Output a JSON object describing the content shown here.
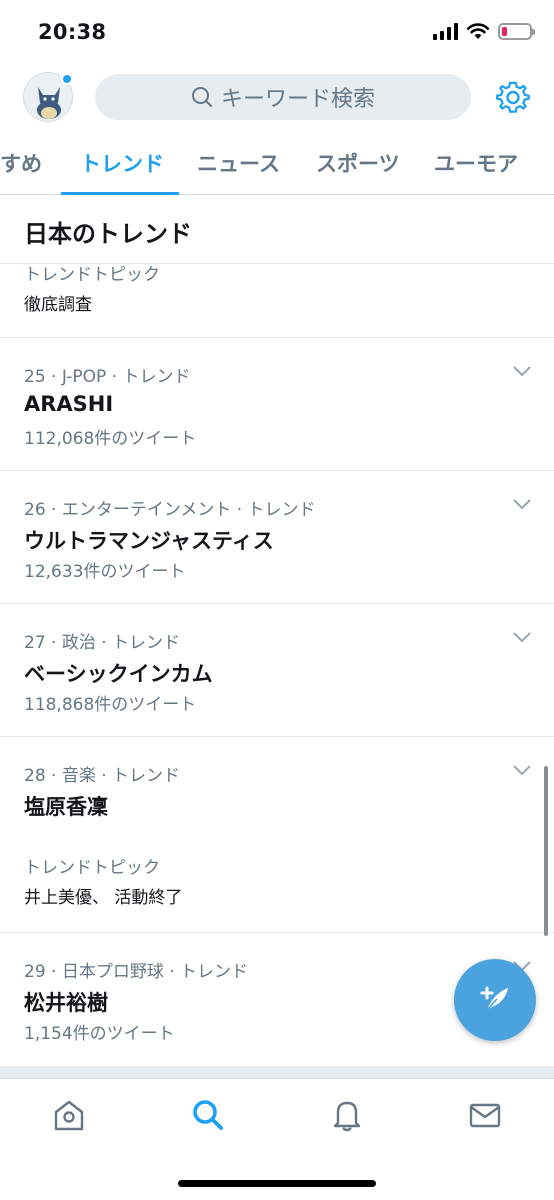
{
  "status_bar": {
    "time": "20:38"
  },
  "header": {
    "search_placeholder": "キーワード検索"
  },
  "tabs": [
    {
      "label": "すめ"
    },
    {
      "label": "トレンド"
    },
    {
      "label": "ニュース"
    },
    {
      "label": "スポーツ"
    },
    {
      "label": "ユーモア"
    }
  ],
  "section_title": "日本のトレンド",
  "partial_item": {
    "topic_label": "トレンドトピック",
    "topic_text": "徹底調査"
  },
  "trends": [
    {
      "meta": "25 · J-POP · トレンド",
      "name": "ARASHI",
      "count": "112,068件のツイート"
    },
    {
      "meta": "26 · エンターテインメント · トレンド",
      "name": "ウルトラマンジャスティス",
      "count": "12,633件のツイート"
    },
    {
      "meta": "27 · 政治 · トレンド",
      "name": "ベーシックインカム",
      "count": "118,868件のツイート"
    },
    {
      "meta": "28 · 音楽 · トレンド",
      "name": "塩原香凜",
      "topic_label": "トレンドトピック",
      "topic_text": "井上美優、 活動終了"
    },
    {
      "meta": "29 · 日本プロ野球 · トレンド",
      "name": "松井裕樹",
      "count": "1,154件のツイート"
    }
  ],
  "colors": {
    "accent": "#1da1f2",
    "muted": "#657786",
    "battery_low": "#e0245e"
  },
  "icons": [
    "search-icon",
    "gear-icon",
    "chevron-down-icon",
    "compose-icon",
    "home-icon",
    "explore-icon",
    "bell-icon",
    "mail-icon"
  ]
}
